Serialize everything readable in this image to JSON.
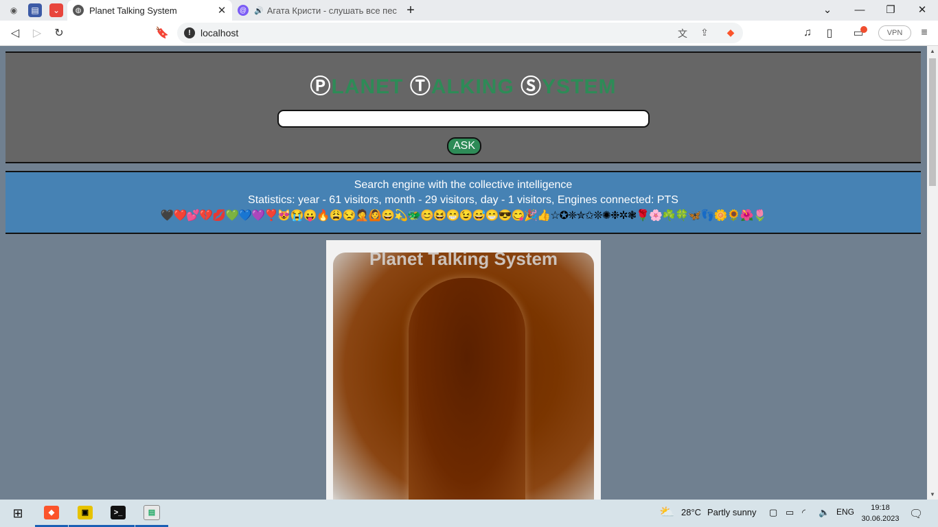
{
  "browser": {
    "tabs": [
      {
        "title": "Planet Talking System",
        "active": true
      },
      {
        "title": "Агата Кристи - слушать все песни",
        "active": false
      }
    ],
    "new_tab": "+",
    "url": "localhost",
    "vpn_label": "VPN"
  },
  "page": {
    "logo": [
      {
        "cap": "Ⓟ",
        "rest": "LANET "
      },
      {
        "cap": "Ⓣ",
        "rest": "ALKING "
      },
      {
        "cap": "Ⓢ",
        "rest": "YSTEM"
      }
    ],
    "ask_button": "ASK",
    "tagline": "Search engine with the collective intelligence",
    "statistics": "Statistics: year - 61 visitors, month - 29 visitors, day - 1 visitors, Engines connected: PTS",
    "emoji_row": "🖤❤️💕💔💋💚💙💜❣️😻😭😛🔥😩😒🤦🙆😄💫🐲😊😆😁😉😅😁😎😋🎉👍☆✪❈✮✩❊✺❉✲❃🌹🌸☘️🍀🦋👣🌼🌻🌺🌷",
    "image_caption": "Planet Talking System"
  },
  "taskbar": {
    "weather_temp": "28°C",
    "weather_text": "Partly sunny",
    "language": "ENG",
    "time": "19:18",
    "date": "30.06.2023"
  },
  "colors": {
    "page_bg": "#708090",
    "header_bg": "#666666",
    "logo_green": "#2e8b57",
    "stats_bg": "#4682b4",
    "ask_bg": "#2e8b57"
  }
}
